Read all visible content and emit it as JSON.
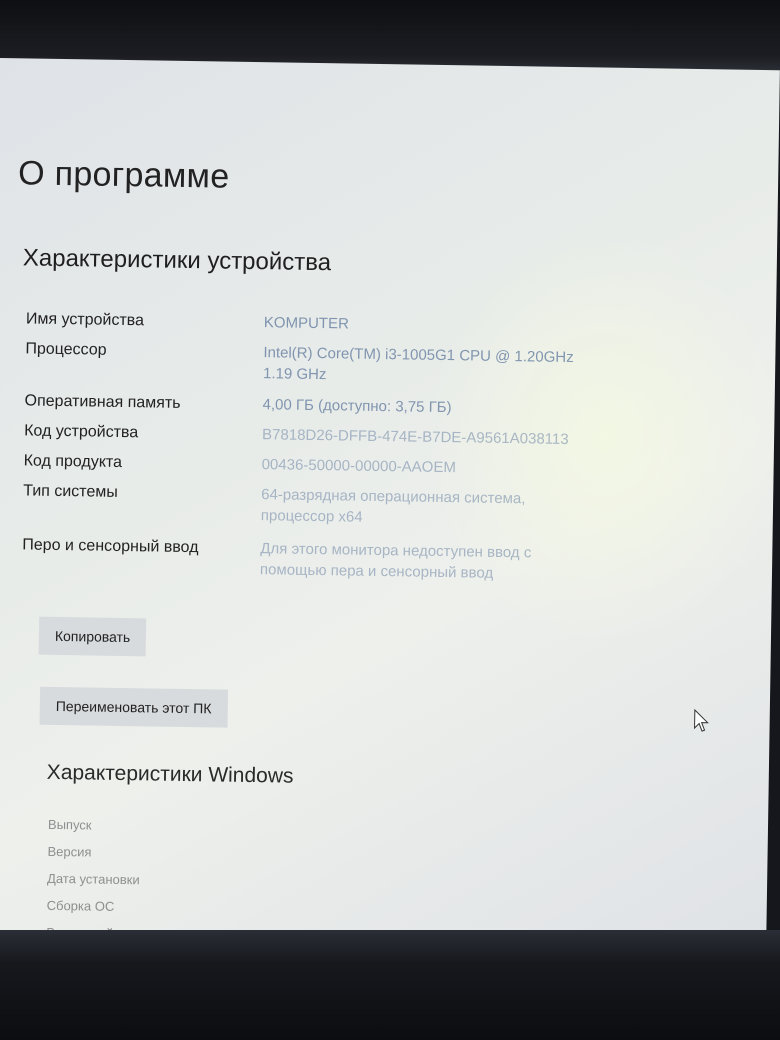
{
  "window": {
    "title": "О программе"
  },
  "device_section": {
    "title": "Характеристики устройства",
    "rows": [
      {
        "label": "Имя устройства",
        "value": "KOMPUTER"
      },
      {
        "label": "Процессор",
        "value": "Intel(R) Core(TM) i3-1005G1 CPU @ 1.20GHz   1.19 GHz"
      },
      {
        "label": "Оперативная память",
        "value": "4,00 ГБ (доступно: 3,75 ГБ)"
      },
      {
        "label": "Код устройства",
        "value": "B7818D26-DFFB-474E-B7DE-A9561A038113"
      },
      {
        "label": "Код продукта",
        "value": "00436-50000-00000-AAOEM"
      },
      {
        "label": "Тип системы",
        "value": "64-разрядная операционная система, процессор x64"
      },
      {
        "label": "Перо и сенсорный ввод",
        "value": "Для этого монитора недоступен ввод с помощью пера и сенсорный ввод"
      }
    ]
  },
  "buttons": {
    "copy": "Копировать",
    "rename": "Переименовать этот ПК"
  },
  "windows_section": {
    "title": "Характеристики Windows",
    "rows": [
      "Выпуск",
      "Версия",
      "Дата установки",
      "Сборка ОС",
      "Взаимодействие"
    ]
  },
  "colors": {
    "screen_bg": "#e6eae8",
    "value_text": "#6f86a6",
    "button_bg": "#d8dbde"
  }
}
